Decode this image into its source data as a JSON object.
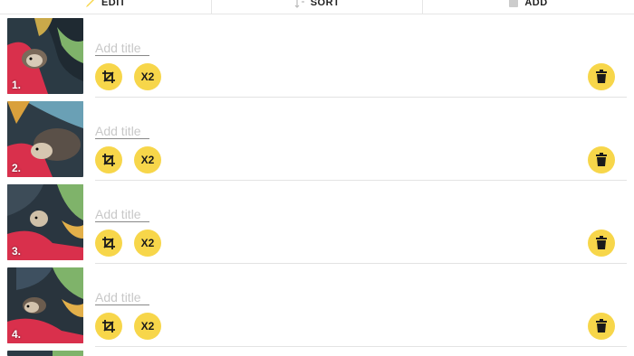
{
  "toolbar": {
    "tabs": [
      {
        "label": "EDIT",
        "icon": "pencil-icon"
      },
      {
        "label": "SORT",
        "icon": "sort-icon"
      },
      {
        "label": "ADD",
        "icon": "add-image-icon"
      }
    ]
  },
  "items": [
    {
      "number": "1.",
      "title_placeholder": "Add title",
      "x2_label": "X2"
    },
    {
      "number": "2.",
      "title_placeholder": "Add title",
      "x2_label": "X2"
    },
    {
      "number": "3.",
      "title_placeholder": "Add title",
      "x2_label": "X2"
    },
    {
      "number": "4.",
      "title_placeholder": "Add title",
      "x2_label": "X2"
    }
  ],
  "colors": {
    "accent": "#f7d64a",
    "divider": "#e3e3e3"
  }
}
